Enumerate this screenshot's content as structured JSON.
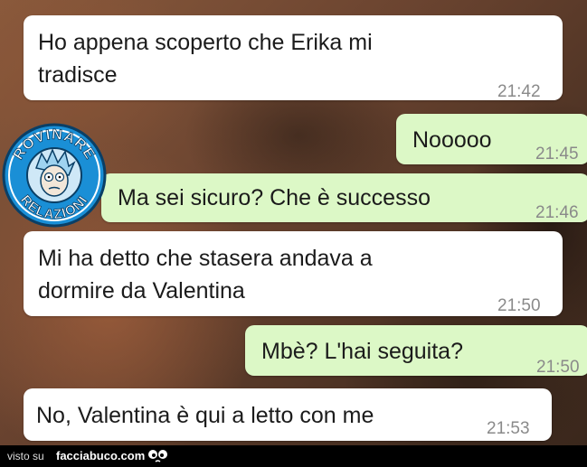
{
  "messages": [
    {
      "type": "incoming",
      "lines": [
        "Ho appena scoperto che Erika mi",
        "tradisce"
      ],
      "time": "21:42"
    },
    {
      "type": "outgoing",
      "lines": [
        "Nooooo"
      ],
      "time": "21:45"
    },
    {
      "type": "outgoing",
      "lines": [
        "Ma sei sicuro? Che è successo"
      ],
      "time": "21:46"
    },
    {
      "type": "incoming",
      "lines": [
        "Mi ha detto che stasera andava a",
        "dormire da Valentina"
      ],
      "time": "21:50"
    },
    {
      "type": "outgoing",
      "lines": [
        "Mbè? L'hai seguita?"
      ],
      "time": "21:50"
    },
    {
      "type": "incoming",
      "lines": [
        "No, Valentina è qui a letto con me"
      ],
      "time": "21:53"
    }
  ],
  "logo": {
    "top_text": "ROVINARE",
    "bottom_text": "RELAZIONI",
    "icon": "rick-face-icon",
    "accent": "#1a8fd6"
  },
  "footer": {
    "prefix": "visto su",
    "site": "facciabuco.com",
    "icon": "eyes-icon"
  },
  "colors": {
    "incoming": "#ffffff",
    "outgoing": "#dcf8c6",
    "time": "#8a8a8a",
    "footer": "#000000"
  }
}
